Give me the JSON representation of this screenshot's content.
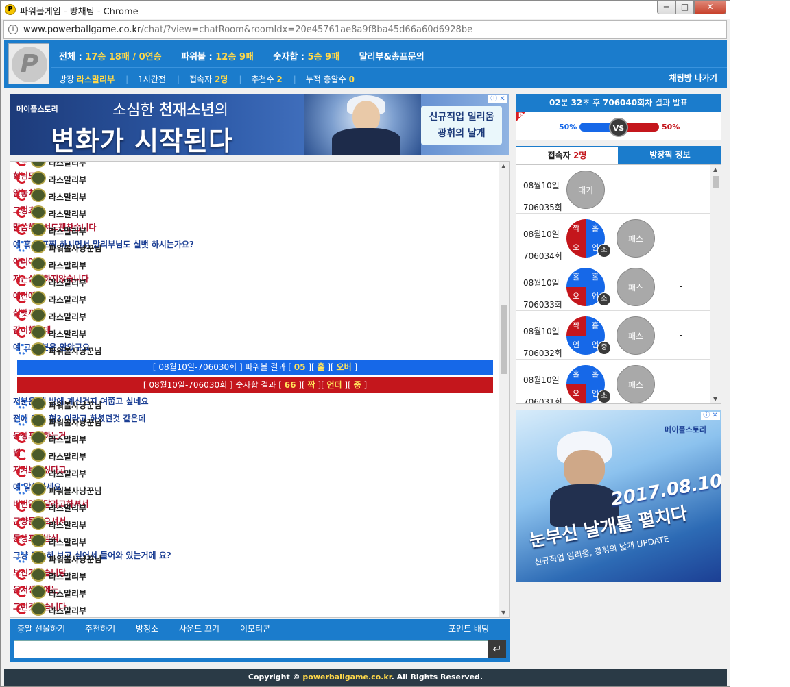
{
  "window": {
    "title": "파워볼게임 - 방채팅 - Chrome",
    "minimize": "─",
    "maximize": "□",
    "close": "✕"
  },
  "address": {
    "host": "www.powerballgame.co.kr",
    "path": "/chat/?view=chatRoom&roomIdx=20e45761ae8a9f8ba45d66a60d6928be"
  },
  "header": {
    "total_label": "전체 : ",
    "total_value": "17승 18패 / 0연승",
    "powerball_label": "파워볼 : ",
    "powerball_value": "12승 9패",
    "sum_label": "숫자합 : ",
    "sum_value": "5승 9패",
    "owner_link": "말리부&총프문의",
    "room_owner_label": "방장",
    "room_owner": "라스말리부",
    "time_ago": "1시간전",
    "users_label": "접속자",
    "users_value": "2명",
    "recommend_label": "추천수",
    "recommend_value": "2",
    "bell_label": "누적 총알수",
    "bell_value": "0",
    "exit": "채팅방 나가기"
  },
  "ad_top": {
    "logo": "메이플스토리",
    "line1_pre": "소심한 ",
    "line1_bold": "천재소년",
    "line1_post": "의",
    "line2": "변화가 시작된다",
    "box_l1": "신규직업 일리움",
    "box_l2": "광휘의 날개",
    "close": "ⓘ ✕"
  },
  "chat": {
    "messages": [
      {
        "user": "라스말리부",
        "text": "형님 도",
        "type": "red"
      },
      {
        "user": "라스말리부",
        "text": "형님도",
        "type": "red"
      },
      {
        "user": "라스말리부",
        "text": "안놓치고",
        "type": "red"
      },
      {
        "user": "라스말리부",
        "text": "그렁쵸",
        "type": "red"
      },
      {
        "user": "라스말리부",
        "text": "말씀해주셔도괜찬습니다",
        "type": "red"
      },
      {
        "user": "파워볼사냥꾼님",
        "text": "예 혹시 프찍 하시면서 말리부님도 실뱃 하시는가요?",
        "type": "blu"
      },
      {
        "user": "라스말리부",
        "text": "아니여",
        "type": "red"
      },
      {
        "user": "라스말리부",
        "text": "저는실뱃하지않습니다",
        "type": "red"
      },
      {
        "user": "라스말리부",
        "text": "예전에는",
        "type": "red"
      },
      {
        "user": "라스말리부",
        "text": "실뱃까지",
        "type": "red"
      },
      {
        "user": "라스말리부",
        "text": "같이했는데",
        "type": "red"
      },
      {
        "user": "파워볼사냥꾼님",
        "text": "예 그 부분은 알았구요",
        "type": "blu"
      }
    ],
    "notice_blue": {
      "pre": "[ 08월10일-706030회 ] 파워볼 결과 [ ",
      "v1": "05",
      "m1": " ][ ",
      "v2": "홀",
      "m2": " ][ ",
      "v3": "오버",
      "post": " ]"
    },
    "notice_red": {
      "pre": "[ 08월10일-706030회 ] 숫자합 결과 [ ",
      "v1": "66",
      "m1": " ][ ",
      "v2": "짝",
      "m2": " ][ ",
      "v3": "언더",
      "m3": " ][ ",
      "v4": "중",
      "post": " ]"
    },
    "messages2": [
      {
        "user": "파워볼사냥꾼님",
        "text": "저분은 왜 방에 계신건지 여쭙고 싶네요",
        "type": "blu"
      },
      {
        "user": "파워볼사냥꾼님",
        "text": "전에 아는 형? 이라고 하셨던것 같은데",
        "type": "blu"
      },
      {
        "user": "라스말리부",
        "text": "동생프찍하는거",
        "type": "red"
      },
      {
        "user": "라스말리부",
        "text": "넵",
        "type": "red"
      },
      {
        "user": "라스말리부",
        "text": "지켜보고싶다고",
        "type": "red"
      },
      {
        "user": "파워볼사냥꾼님",
        "text": "예 말씀하세요",
        "type": "blu"
      },
      {
        "user": "라스말리부",
        "text": "비번알려달라고하셔서",
        "type": "red"
      },
      {
        "user": "라스말리부",
        "text": "근양들어오셔서",
        "type": "red"
      },
      {
        "user": "라스말리부",
        "text": "동생프찍방식",
        "type": "red"
      },
      {
        "user": "파워볼사냥꾼님",
        "text": "그냥 단순히 보고 싶어서 들어와 있는거에 요?",
        "type": "blu"
      },
      {
        "user": "라스말리부",
        "text": "보신거같습니당",
        "type": "red"
      },
      {
        "user": "라스말리부",
        "text": "음저생각에는",
        "type": "red"
      },
      {
        "user": "라스말리부",
        "text": "그런것같습니다",
        "type": "red"
      }
    ]
  },
  "toolbar": {
    "gift": "총알 선물하기",
    "recommend": "추천하기",
    "cleaner": "방청소",
    "sound_off": "사운드 끄기",
    "emoticon": "이모티콘",
    "point_bet": "포인트 배팅"
  },
  "input": {
    "placeholder": "",
    "send": "↵"
  },
  "result": {
    "countdown_pre": "",
    "min": "02",
    "min_unit": "분 ",
    "sec": "32",
    "sec_unit": "초 후 ",
    "round": "706040회차",
    "round_post": " 결과 발표",
    "badge": "P",
    "left_pct": "50%",
    "right_pct": "50%",
    "left_share": 50,
    "vs": "VS"
  },
  "tabs": {
    "users_pre": "접속자 ",
    "users_count": "2명",
    "picks": "방장픽 정보"
  },
  "rounds": [
    {
      "date": "08월10일",
      "round": "706035회",
      "status": "대기"
    },
    {
      "date": "08월10일",
      "round": "706034회",
      "q": [
        "짝",
        "홀",
        "오",
        "언"
      ],
      "c": [
        "r",
        "b",
        "r",
        "b"
      ],
      "size": "소",
      "pick": "패스",
      "res": "-"
    },
    {
      "date": "08월10일",
      "round": "706033회",
      "q": [
        "홀",
        "홀",
        "오",
        "언"
      ],
      "c": [
        "b",
        "b",
        "r",
        "b"
      ],
      "size": "소",
      "pick": "패스",
      "res": "-"
    },
    {
      "date": "08월10일",
      "round": "706032회",
      "q": [
        "짝",
        "홀",
        "언",
        "언"
      ],
      "c": [
        "r",
        "b",
        "b",
        "b"
      ],
      "size": "중",
      "pick": "패스",
      "res": "-"
    },
    {
      "date": "08월10일",
      "round": "706031회",
      "q": [
        "홀",
        "홀",
        "오",
        "언"
      ],
      "c": [
        "b",
        "b",
        "r",
        "b"
      ],
      "size": "소",
      "pick": "패스",
      "res": "-"
    }
  ],
  "ad_side": {
    "logo": "메이플스토리",
    "date": "2017.08.10",
    "big": "눈부신 날개를 펼치다",
    "sub": "신규직업 일리움, 광휘의 날개 UPDATE",
    "close": "ⓘ ✕"
  },
  "footer": {
    "pre": "Copyright © ",
    "site": "powerballgame.co.kr",
    "post": ". All Rights Reserved."
  },
  "colors": {
    "primary": "#1b7ccc",
    "red": "#c4161c",
    "blue": "#1668e8",
    "gold": "#ffd84a"
  }
}
